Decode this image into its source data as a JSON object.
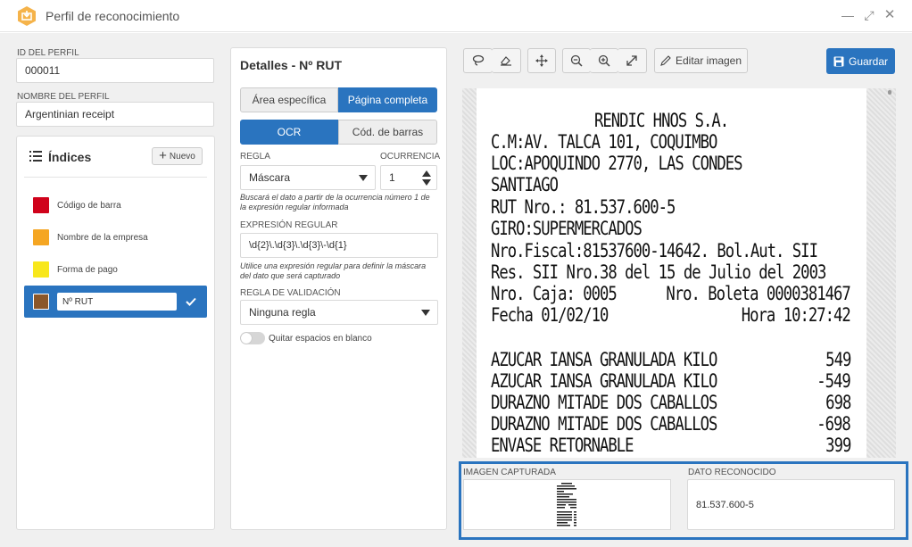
{
  "window": {
    "title": "Perfil de reconocimiento",
    "controls": {
      "minimize": "—",
      "maximize": "⤢",
      "close": "✕"
    }
  },
  "profile": {
    "id_label": "ID DEL PERFIL",
    "id_value": "000011",
    "name_label": "NOMBRE DEL PERFIL",
    "name_value": "Argentinian receipt"
  },
  "indices": {
    "title": "Índices",
    "new_label": "Nuevo",
    "items": [
      {
        "label": "Código de barra",
        "color": "#d0021b"
      },
      {
        "label": "Nombre de la empresa",
        "color": "#f5a623"
      },
      {
        "label": "Forma de pago",
        "color": "#f8e71c"
      },
      {
        "label": "Nº RUT",
        "color": "#8b572a",
        "selected": true
      }
    ]
  },
  "details": {
    "title": "Detalles - Nº RUT",
    "area_tabs": [
      {
        "label": "Área específica",
        "active": false
      },
      {
        "label": "Página completa",
        "active": true
      }
    ],
    "mode_tabs": [
      {
        "label": "OCR",
        "active": true
      },
      {
        "label": "Cód. de barras",
        "active": false
      }
    ],
    "rule_label": "REGLA",
    "rule_value": "Máscara",
    "occurrence_label": "OCURRENCIA",
    "occurrence_value": "1",
    "rule_hint": "Buscará el dato a partir de la ocurrencia número 1 de la expresión regular informada",
    "regex_label": "EXPRESIÓN REGULAR",
    "regex_value": "\\d{2}\\.\\d{3}\\.\\d{3}\\-\\d{1}",
    "regex_hint": "Utilice una expresión regular para definir la máscara del dato que será capturado",
    "validation_label": "REGLA DE VALIDACIÓN",
    "validation_value": "Ninguna regla",
    "toggle_label": "Quitar espacios en blanco",
    "toggle_on": false
  },
  "toolbar": {
    "edit_image": "Editar imagen",
    "save": "Guardar",
    "accent": "#2a74bf"
  },
  "receipt": {
    "header_lines": [
      "RENDIC HNOS S.A.",
      "C.M:AV. TALCA 101, COQUIMBO",
      "LOC:APOQUINDO 2770, LAS CONDES",
      "SANTIAGO",
      "RUT Nro.: 81.537.600-5",
      "GIRO:SUPERMERCADOS",
      "Nro.Fiscal:81537600-14642. Bol.Aut. SII",
      "Res. SII Nro.38 del 15 de Julio del 2003"
    ],
    "caja": "Nro. Caja: 0005",
    "boleta": "Nro. Boleta 0000381467",
    "fecha": "Fecha 01/02/10",
    "hora": "Hora 10:27:42",
    "items": [
      {
        "name": "AZUCAR IANSA GRANULADA KILO",
        "amount": "549"
      },
      {
        "name": "AZUCAR IANSA GRANULADA KILO",
        "amount": "-549"
      },
      {
        "name": "DURAZNO MITADE DOS CABALLOS",
        "amount": "698"
      },
      {
        "name": "DURAZNO MITADE DOS CABALLOS",
        "amount": "-698"
      },
      {
        "name": "ENVASE RETORNABLE",
        "amount": "399"
      }
    ]
  },
  "capture": {
    "image_label": "IMAGEN CAPTURADA",
    "data_label": "DATO RECONOCIDO",
    "data_value": "81.537.600-5",
    "highlight_color": "#2a74bf"
  }
}
